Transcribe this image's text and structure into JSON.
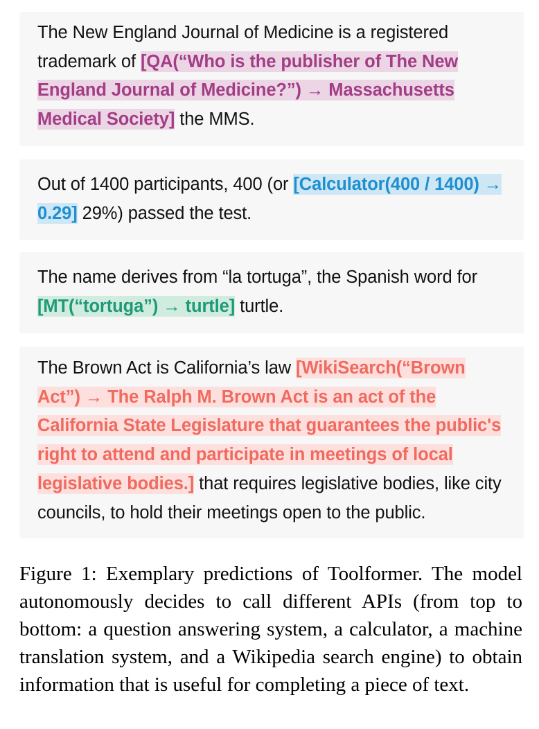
{
  "examples": [
    {
      "before": "The New England Journal of Medicine is a registered trademark of ",
      "call": "[QA(“Who is the publisher of The New England Journal of Medicine?”) → Massachusetts Medical Society]",
      "after": " the MMS.",
      "color": "#a23d86",
      "highlight": "#ecd6e5"
    },
    {
      "before": "Out of 1400 participants, 400 (or ",
      "call": "[Calculator(400 / 1400) → 0.29]",
      "after": " 29%) passed the test.",
      "color": "#1e8fcf",
      "highlight": "#cfe7f5"
    },
    {
      "before": "The name derives from “la tortuga”, the Spanish word for ",
      "call": "[MT(“tortuga”) → turtle]",
      "after": " turtle.",
      "color": "#1f9a78",
      "highlight": "#d0ecdf"
    },
    {
      "before": "The Brown Act is California’s law ",
      "call": "[WikiSearch(“Brown Act”) → The Ralph M. Brown Act is an act of the California State Legislature that guarantees the public's right to attend and participate in meetings of local legislative bodies.]",
      "after": " that requires legislative bodies, like city councils, to hold their meetings open to the public.",
      "color": "#f06a5f",
      "highlight": "#fde0dd"
    }
  ],
  "caption": "Figure 1: Exemplary predictions of Toolformer. The model autonomously decides to call different APIs (from top to bottom: a question answering system, a calculator, a machine translation system, and a Wikipedia search engine) to obtain information that is useful for completing a piece of text."
}
